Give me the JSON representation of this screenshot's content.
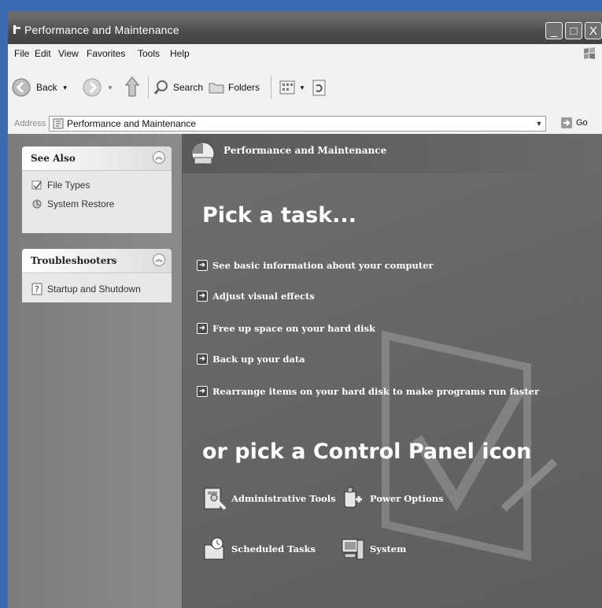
{
  "window": {
    "title": "Performance and Maintenance",
    "controls": [
      "_",
      "□",
      "X"
    ]
  },
  "menu": [
    "File",
    "Edit",
    "View",
    "Favorites",
    "Tools",
    "Help"
  ],
  "toolbar": {
    "back": "Back",
    "search": "Search",
    "folders": "Folders"
  },
  "address": {
    "label": "Address",
    "value": "Performance and Maintenance",
    "go": "Go"
  },
  "see_also": {
    "title": "See Also",
    "items": [
      "File Types",
      "System Restore"
    ]
  },
  "troubleshooters": {
    "title": "Troubleshooters",
    "items": [
      "Startup and Shutdown"
    ]
  },
  "content": {
    "header": "Performance and Maintenance",
    "pick_task": "Pick a task...",
    "tasks": [
      "See basic information about your computer",
      "Adjust visual effects",
      "Free up space on your hard disk",
      "Back up your data",
      "Rearrange items on your hard disk to make programs run faster"
    ],
    "pick_icon": "or pick a Control Panel icon",
    "icons": [
      "Administrative Tools",
      "Power Options",
      "Scheduled Tasks",
      "System"
    ]
  }
}
